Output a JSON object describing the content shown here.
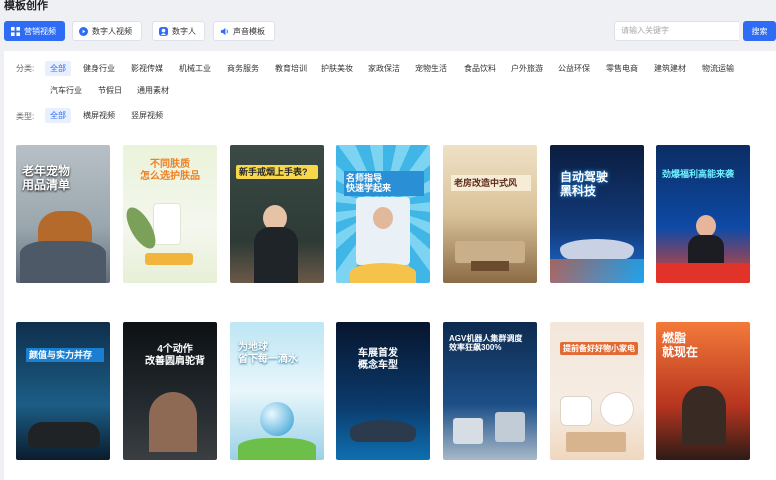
{
  "page": {
    "title": "模板创作"
  },
  "toolbar": {
    "tabs": [
      {
        "label": "营销视频",
        "icon": "grid-icon",
        "active": true
      },
      {
        "label": "数字人视频",
        "icon": "play-circle-icon",
        "active": false
      },
      {
        "label": "数字人",
        "icon": "avatar-icon",
        "active": false
      },
      {
        "label": "声音模板",
        "icon": "speaker-icon",
        "active": false
      }
    ],
    "search_placeholder": "请输入关键字",
    "search_button": "搜索"
  },
  "filters": {
    "category_label": "分类:",
    "categories": [
      "全部",
      "健身行业",
      "影视传媒",
      "机械工业",
      "商务服务",
      "教育培训",
      "护肤美妆",
      "家政保洁",
      "宠物生活",
      "食品饮料",
      "户外旅游",
      "公益环保",
      "零售电商",
      "建筑建材",
      "物流运输",
      "汽车行业",
      "节假日",
      "通用素材"
    ],
    "type_label": "类型:",
    "types": [
      "全部",
      "横屏视频",
      "竖屏视频"
    ]
  },
  "cards": [
    {
      "caption": "老年宠物\n用品清单",
      "theme": "pet"
    },
    {
      "caption": "不同肤质\n怎么选护肤品",
      "theme": "skin"
    },
    {
      "caption": "新手戒烟上手表?",
      "theme": "teacher"
    },
    {
      "caption": "名师指导\n快速学起来",
      "theme": "snow"
    },
    {
      "caption": "老房改造中式风",
      "theme": "interior"
    },
    {
      "caption": "自动驾驶\n黑科技",
      "theme": "car-neon"
    },
    {
      "caption": "劲爆福利高能来袭",
      "theme": "live"
    },
    {
      "caption": "颜值与实力并存",
      "theme": "suv"
    },
    {
      "caption": "4个动作\n改善圆肩驼背",
      "theme": "gym"
    },
    {
      "caption": "为地球\n省下每一滴水",
      "theme": "water"
    },
    {
      "caption": "车展首发\n概念车型",
      "theme": "concept"
    },
    {
      "caption": "AGV机器人集群调度\n效率狂飙300%",
      "theme": "robot"
    },
    {
      "caption": "提前备好好物小家电",
      "theme": "appliance"
    },
    {
      "caption": "燃脂\n就现在",
      "theme": "fitness"
    }
  ],
  "colors": {
    "accent": "#2f6cf6"
  }
}
